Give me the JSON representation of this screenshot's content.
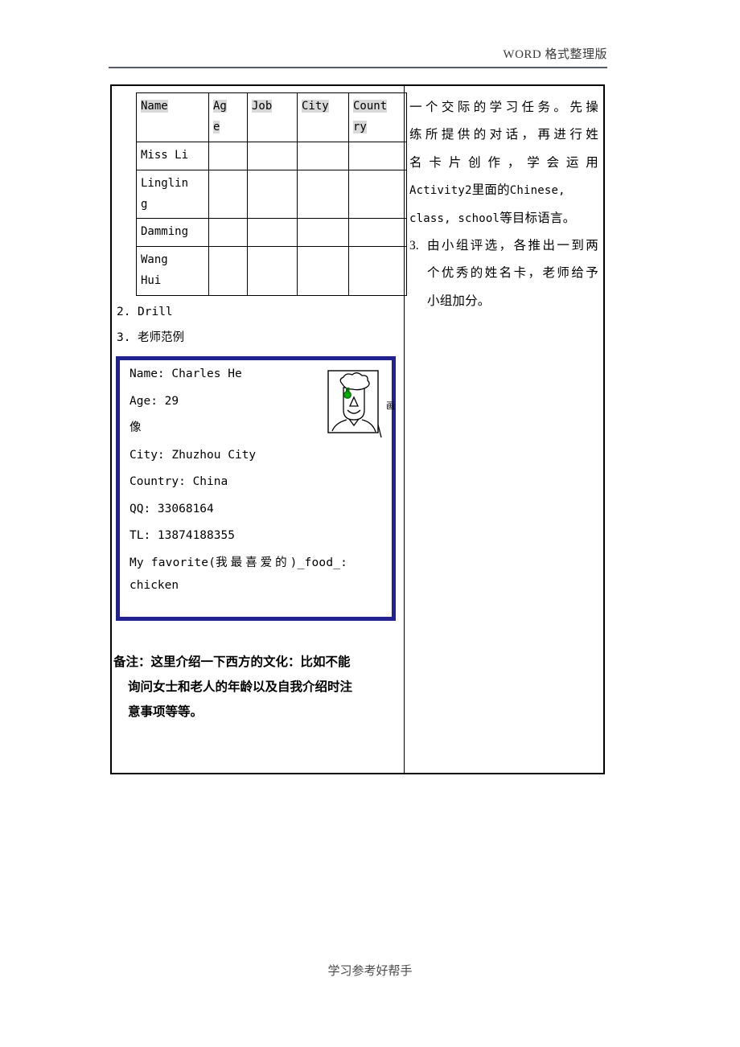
{
  "header": {
    "title": "WORD 格式整理版"
  },
  "footer": {
    "text": "学习参考好帮手"
  },
  "left_column": {
    "roster_table": {
      "columns": [
        "Name",
        "Age",
        "Job",
        "City",
        "Country"
      ],
      "header_parts": {
        "name": "Name",
        "age_1": "Ag",
        "age_2": "e",
        "job": "Job",
        "city": "City",
        "country_1": "Count",
        "country_2": "ry"
      },
      "rows": [
        {
          "name": "Miss Li",
          "name_2": "",
          "age": "",
          "job": "",
          "city": "",
          "country": ""
        },
        {
          "name": "Linglin",
          "name_2": "g",
          "age": "",
          "job": "",
          "city": "",
          "country": ""
        },
        {
          "name": "Damming",
          "name_2": "",
          "age": "",
          "job": "",
          "city": "",
          "country": ""
        },
        {
          "name": "Wang",
          "name_2": "Hui",
          "age": "",
          "job": "",
          "city": "",
          "country": ""
        }
      ]
    },
    "list_items": [
      {
        "num": "2.",
        "text": "Drill"
      },
      {
        "num": "3.",
        "text": "老师范例"
      }
    ],
    "name_card": {
      "border_color": "#21228f",
      "lines": [
        "Name: Charles He",
        "Age:  29",
        "像",
        "City: Zhuzhou City",
        "Country: China",
        "QQ: 33068164",
        "TL: 13874188355"
      ],
      "line_name": "Name: Charles He",
      "line_age": "Age:  29",
      "line_xiang": "像",
      "line_city": "City: Zhuzhou City",
      "line_country": "Country: China",
      "line_qq": "QQ: 33068164",
      "line_tl": "TL: 13874188355",
      "favorite_prefix": "My  favorite(",
      "favorite_cjk": "我最喜爱的",
      "favorite_suffix": ")_food_:",
      "favorite_value": "chicken",
      "portrait_label": "画",
      "portrait_accent": "#00a800"
    },
    "note": {
      "line1": "备注：这里介绍一下西方的文化：比如不能",
      "line2": "询问女士和老人的年龄以及自我介绍时注",
      "line3": "意事项等等。"
    }
  },
  "right_column": {
    "paragraph_1": {
      "line1": "一个交际的学习任务。先操",
      "line2": "练所提供的对话，再进行姓",
      "line3": "名卡片创作，学会运用",
      "line4_mono_a": "Activity2",
      "line4_cjk": "里面的",
      "line4_mono_b": "Chinese,",
      "line5_mono_a": "class, school",
      "line5_cjk": "等目标语言。"
    },
    "item_3": {
      "num": "3.",
      "line1": "由小组评选，各推出一到两",
      "line2": "个优秀的姓名卡，老师给予",
      "line3": "小组加分。"
    }
  }
}
